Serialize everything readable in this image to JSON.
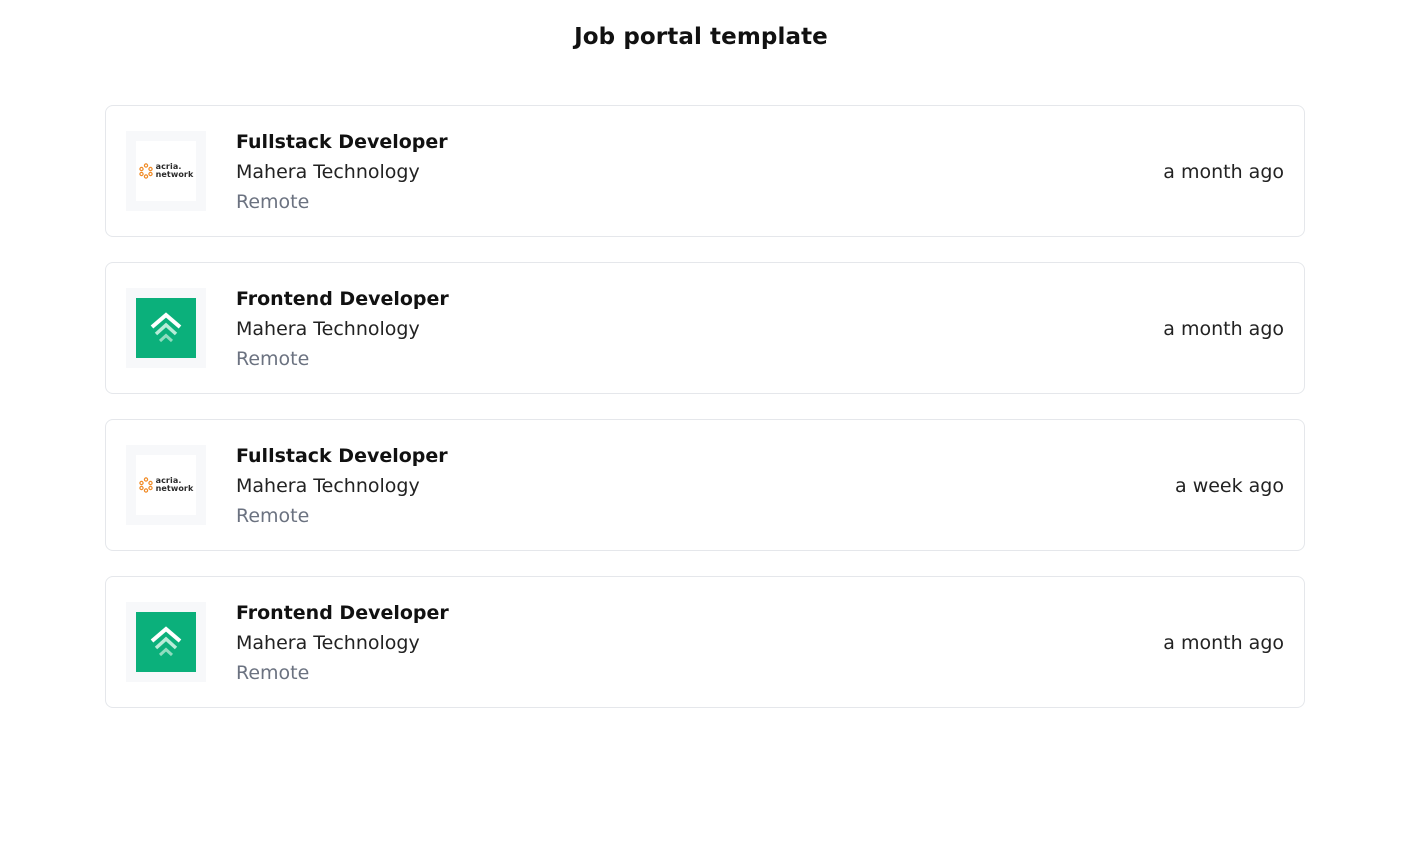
{
  "page": {
    "title": "Job portal template"
  },
  "jobs": [
    {
      "title": "Fullstack Developer",
      "company": "Mahera Technology",
      "location": "Remote",
      "posted": "a month ago",
      "logo": "acria-network-logo",
      "logo_text": [
        "acria.",
        "network"
      ]
    },
    {
      "title": "Frontend Developer",
      "company": "Mahera Technology",
      "location": "Remote",
      "posted": "a month ago",
      "logo": "green-chevron-logo"
    },
    {
      "title": "Fullstack Developer",
      "company": "Mahera Technology",
      "location": "Remote",
      "posted": "a week ago",
      "logo": "acria-network-logo",
      "logo_text": [
        "acria.",
        "network"
      ]
    },
    {
      "title": "Frontend Developer",
      "company": "Mahera Technology",
      "location": "Remote",
      "posted": "a month ago",
      "logo": "green-chevron-logo"
    }
  ],
  "colors": {
    "green_logo_bg": "#0bb07b",
    "acria_orange": "#f08a24",
    "card_border": "#e5e7eb",
    "muted_text": "#6b7280"
  }
}
